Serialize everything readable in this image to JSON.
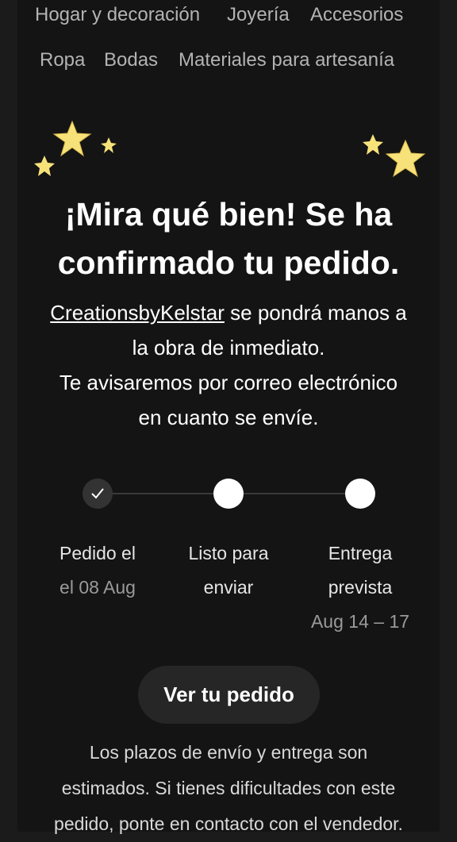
{
  "categories": {
    "row1": [
      "Hogar y decoración",
      "Joyería",
      "Accesorios"
    ],
    "row2": [
      "Ropa",
      "Bodas",
      "Materiales para artesanía"
    ]
  },
  "confirmation": {
    "title_line1": "¡Mira qué bien! Se ha",
    "title_line2": "confirmado tu pedido.",
    "seller_name": "CreationsbyKelstar",
    "message_line1_rest": " se pondrá manos a",
    "message_line2": "la obra de inmediato.",
    "message_line3": "Te avisaremos por correo electrónico",
    "message_line4": "en cuanto se envíe."
  },
  "tracker": {
    "steps": [
      {
        "label": "Pedido el",
        "sub": "el 08 Aug",
        "status": "done"
      },
      {
        "label_line1": "Listo para",
        "label_line2": "enviar",
        "status": "pending"
      },
      {
        "label_line1": "Entrega",
        "label_line2": "prevista",
        "sub": "Aug 14 – 17",
        "status": "pending"
      }
    ]
  },
  "actions": {
    "view_order_label": "Ver tu pedido"
  },
  "footer_note": {
    "line1": "Los plazos de envío y entrega son",
    "line2": "estimados. Si tienes dificultades con este",
    "line3": "pedido, ponte en contacto con el vendedor."
  },
  "colors": {
    "background": "#141414",
    "star": "#f7e27a",
    "button": "#262626"
  },
  "icons": [
    "sparkle-star-icon",
    "checkmark-icon"
  ]
}
